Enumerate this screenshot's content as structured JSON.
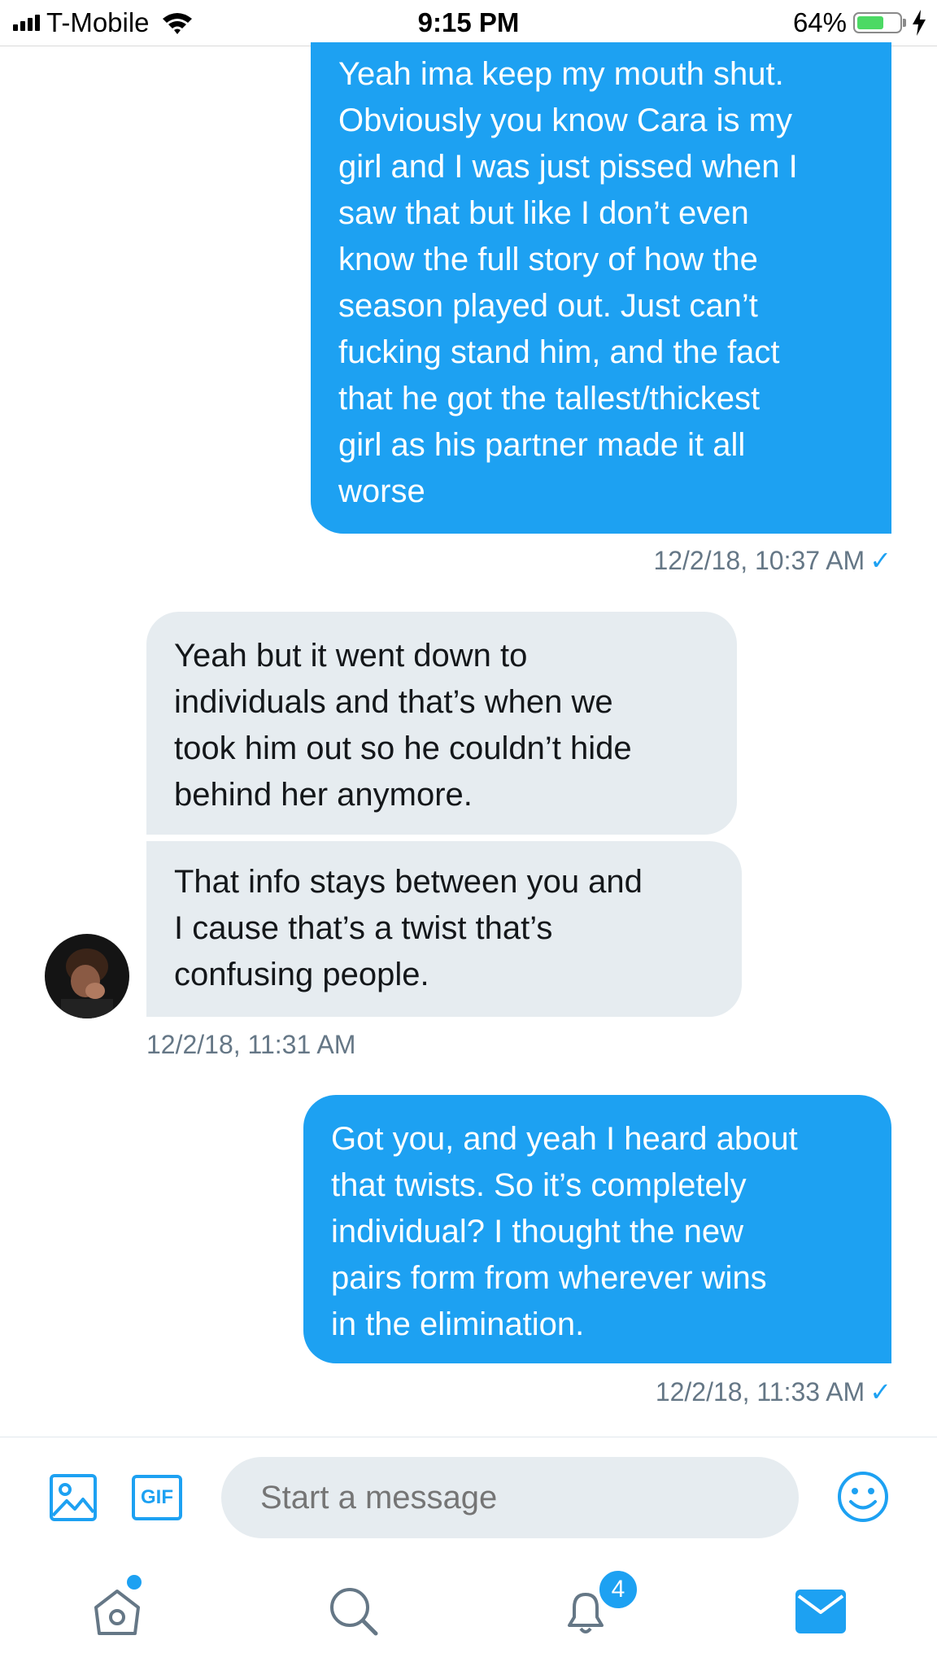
{
  "status_bar": {
    "carrier": "T-Mobile",
    "time": "9:15 PM",
    "battery_percent": "64%",
    "battery_level": 0.64,
    "icons": [
      "signal-icon",
      "wifi-icon",
      "battery-icon",
      "charging-bolt-icon"
    ]
  },
  "conversation": {
    "messages": [
      {
        "direction": "sent",
        "text": "Yeah ima keep my mouth shut.\nObviously you know Cara is my\ngirl and I was just pissed when I\nsaw that but like I don’t even\nknow the full story of how the\nseason played out. Just can’t\nfucking stand him, and the fact\nthat he got the tallest/thickest\ngirl as his partner made it all\nworse"
      },
      {
        "direction": "sent",
        "timestamp": "12/2/18, 10:37 AM",
        "read_check": "✓"
      },
      {
        "direction": "received",
        "text": "Yeah but it went down to\nindividuals and that’s when we\ntook him out so he couldn’t hide\nbehind her anymore."
      },
      {
        "direction": "received",
        "text": "That info stays between you and\nI cause that’s a twist that’s\nconfusing people."
      },
      {
        "direction": "received",
        "timestamp": "12/2/18, 11:31 AM"
      },
      {
        "direction": "sent",
        "text": "Got you, and yeah I heard about\nthat twists. So it’s completely\nindividual? I thought the new\npairs form from wherever wins\nin the elimination."
      },
      {
        "direction": "sent",
        "timestamp": "12/2/18, 11:33 AM",
        "read_check": "✓"
      }
    ]
  },
  "composer": {
    "placeholder": "Start a message",
    "gif_label": "GIF",
    "icons": [
      "image-icon",
      "gif-icon",
      "emoji-icon"
    ]
  },
  "tabbar": {
    "notifications_badge": "4",
    "icons": [
      "home-icon",
      "search-icon",
      "notifications-icon",
      "messages-icon"
    ],
    "active_tab": "messages"
  },
  "colors": {
    "accent": "#1da1f2",
    "received_bubble": "#e6ecf0",
    "timestamp": "#657786",
    "battery": "#4cd964"
  }
}
